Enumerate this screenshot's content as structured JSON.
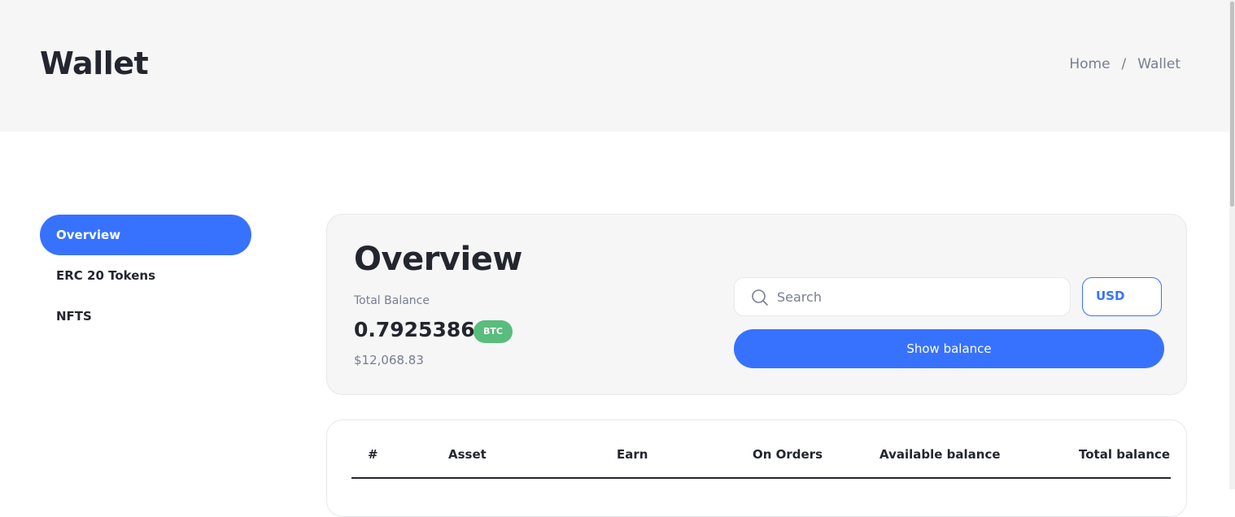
{
  "header": {
    "title": "Wallet",
    "breadcrumb": [
      "Home",
      "/",
      "Wallet"
    ]
  },
  "sidebar": {
    "items": [
      {
        "label": "Overview",
        "active": true
      },
      {
        "label": "ERC 20 Tokens",
        "active": false
      },
      {
        "label": "NFTS",
        "active": false
      }
    ]
  },
  "overview": {
    "title": "Overview",
    "total_balance_label": "Total Balance",
    "amount": "0.79253864",
    "currency_badge": "BTC",
    "fiat_value": "$12,068.83",
    "search": {
      "placeholder": "Search",
      "value": ""
    },
    "currency_select": "USD",
    "show_balance_label": "Show balance"
  },
  "table": {
    "columns": [
      "#",
      "Asset",
      "Earn",
      "On Orders",
      "Available balance",
      "Total balance"
    ]
  },
  "colors": {
    "accent": "#3772ff",
    "badge_green": "#58bd7d",
    "header_bg": "#f6f6f6",
    "text_dark": "#23262f",
    "text_muted": "#777e90"
  }
}
